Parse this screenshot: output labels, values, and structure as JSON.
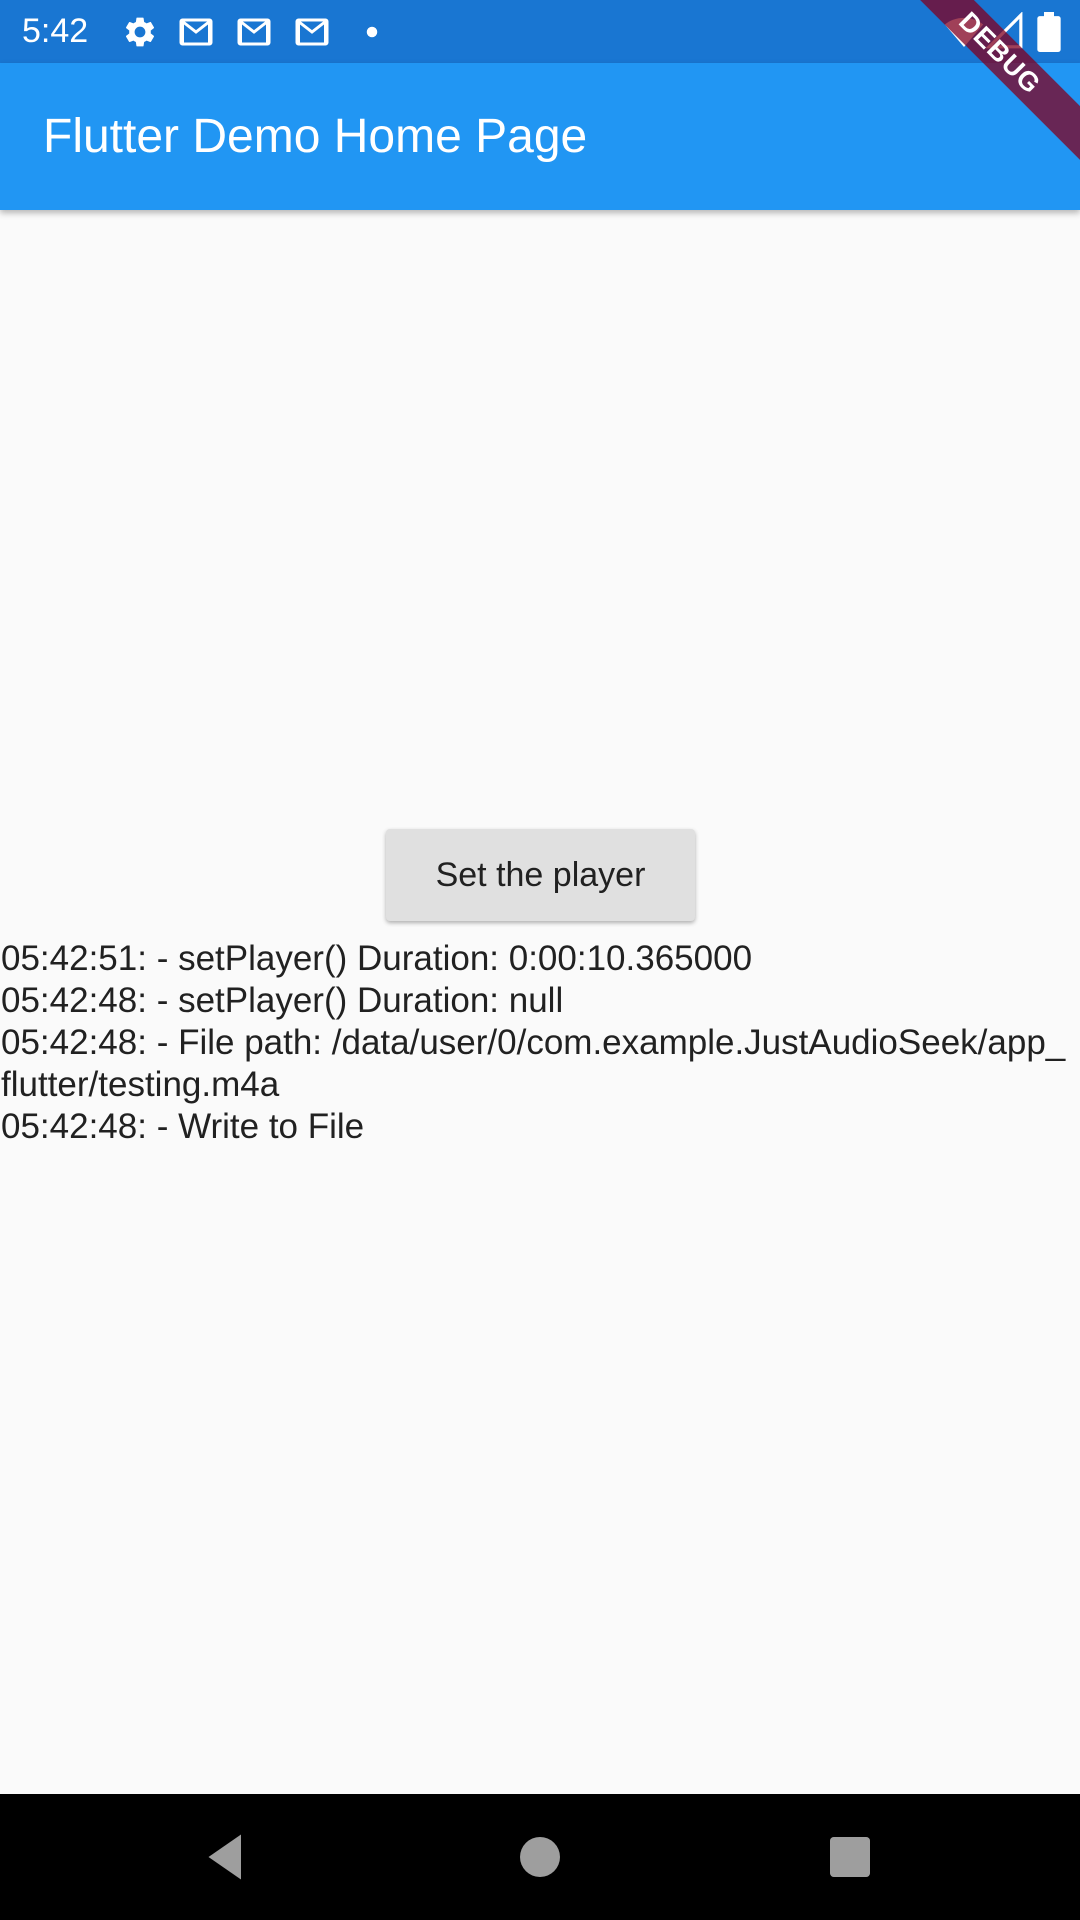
{
  "status_bar": {
    "time": "5:42",
    "icons": [
      "settings-icon",
      "gmail-icon",
      "gmail-icon",
      "gmail-icon",
      "notification-dot-icon",
      "wifi-icon",
      "signal-icon",
      "battery-icon"
    ]
  },
  "app_bar": {
    "title": "Flutter Demo Home Page"
  },
  "debug_banner": {
    "label": "DEBUG"
  },
  "main": {
    "button_label": "Set the player",
    "logs": [
      "05:42:51: - setPlayer() Duration: 0:00:10.365000",
      "05:42:48: - setPlayer() Duration: null",
      "05:42:48: - File path: /data/user/0/com.example.JustAudioSeek/app_flutter/testing.m4a",
      "05:42:48: - Write to File"
    ]
  },
  "nav_bar": {
    "buttons": [
      "back-icon",
      "home-icon",
      "recents-icon"
    ]
  },
  "colors": {
    "status_bar": "#1976d2",
    "app_bar": "#2196f3",
    "background": "#fafafa",
    "button": "#e0e0e0",
    "nav_bar": "#000000",
    "debug_banner": "#800020"
  }
}
